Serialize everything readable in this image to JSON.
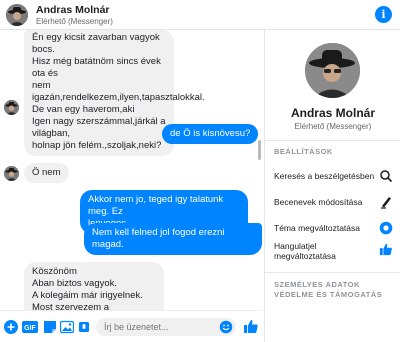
{
  "header": {
    "name": "Andras Molnár",
    "status": "Elérhető (Messenger)"
  },
  "messages": [
    {
      "dir": "in",
      "lines": [
        "Én egy kicsit zavarban vagyok bocs.",
        "Hisz még batátnöm sincs évek ota és",
        "nem",
        "igazán,rendelkezem,ilyen,tapasztalokkal.",
        "De van egy haverom,aki",
        "Igen nagy szerszámmal,járkál a világban,",
        "holnap jön felém.,szoljak,neki?"
      ]
    },
    {
      "dir": "out",
      "lines": [
        "de Ö is kisnövesu?"
      ]
    },
    {
      "dir": "in",
      "lines": [
        "Ö nem"
      ]
    },
    {
      "dir": "out",
      "lines": [
        "Akkor nem jo, teged igy talatunk meg. Ez",
        "lenyeges."
      ]
    },
    {
      "dir": "out",
      "lines": [
        "Nem kell felned jol fogod erezni magad."
      ]
    },
    {
      "dir": "in",
      "lines": [
        "Köszönöm",
        "Aban biztos vagyok.",
        "A kolegáim már irigyelnek.",
        "Most szervezem a hiányzásomat."
      ]
    }
  ],
  "composer": {
    "placeholder": "Írj be üzenetet..."
  },
  "panel": {
    "name": "Andras Molnár",
    "status": "Elérhető (Messenger)",
    "settings_title": "BEÁLLÍTÁSOK",
    "settings": [
      {
        "label": "Keresés a beszélgetésben",
        "icon": "search-icon"
      },
      {
        "label": "Becenevek módosítása",
        "icon": "pencil-icon"
      },
      {
        "label": "Téma megváltoztatása",
        "icon": "theme-icon"
      },
      {
        "label": "Hangulatjel megváltoztatása",
        "icon": "thumbs-up-icon"
      }
    ],
    "privacy_title": "SZEMÉLYES ADATOK VÉDELME ÉS TÁMOGATÁS"
  },
  "colors": {
    "accent": "#0084ff",
    "incoming_bubble": "#f1f0f0",
    "text": "#1c1e21",
    "secondary_text": "#65676b"
  }
}
